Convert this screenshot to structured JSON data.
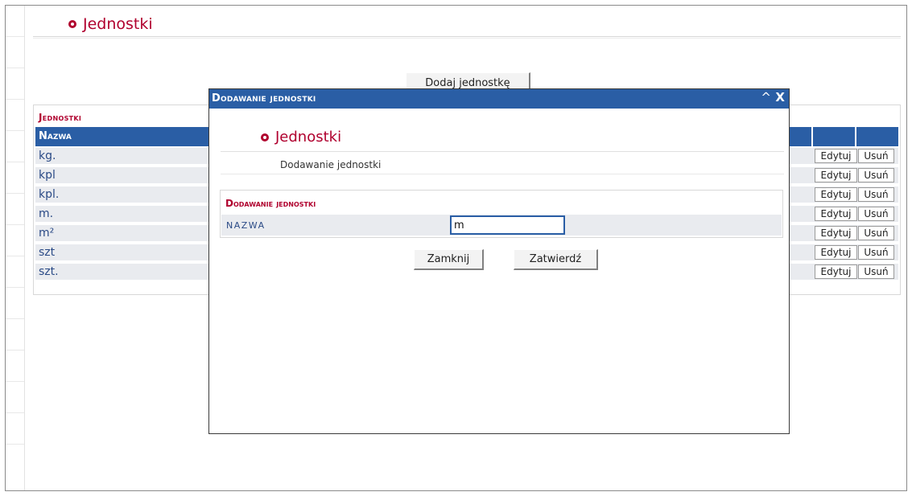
{
  "page": {
    "title": "Jednostki",
    "add_button": "Dodaj jednostkę"
  },
  "units": {
    "caption": "Jednostki",
    "header": {
      "name": "Nazwa"
    },
    "edit_label": "Edytuj",
    "delete_label": "Usuń",
    "rows": [
      "kg.",
      "kpl",
      "kpl.",
      "m.",
      "m²",
      "szt",
      "szt."
    ]
  },
  "modal": {
    "title": "Dodawanie jednostki",
    "heading": "Jednostki",
    "subtitle": "Dodawanie jednostki",
    "form_caption": "Dodawanie jednostki",
    "field_label": "NAZWA",
    "field_value": "m",
    "close_button": "Zamknij",
    "submit_button": "Zatwierdź",
    "minimize_glyph": "^",
    "close_glyph": "X"
  }
}
